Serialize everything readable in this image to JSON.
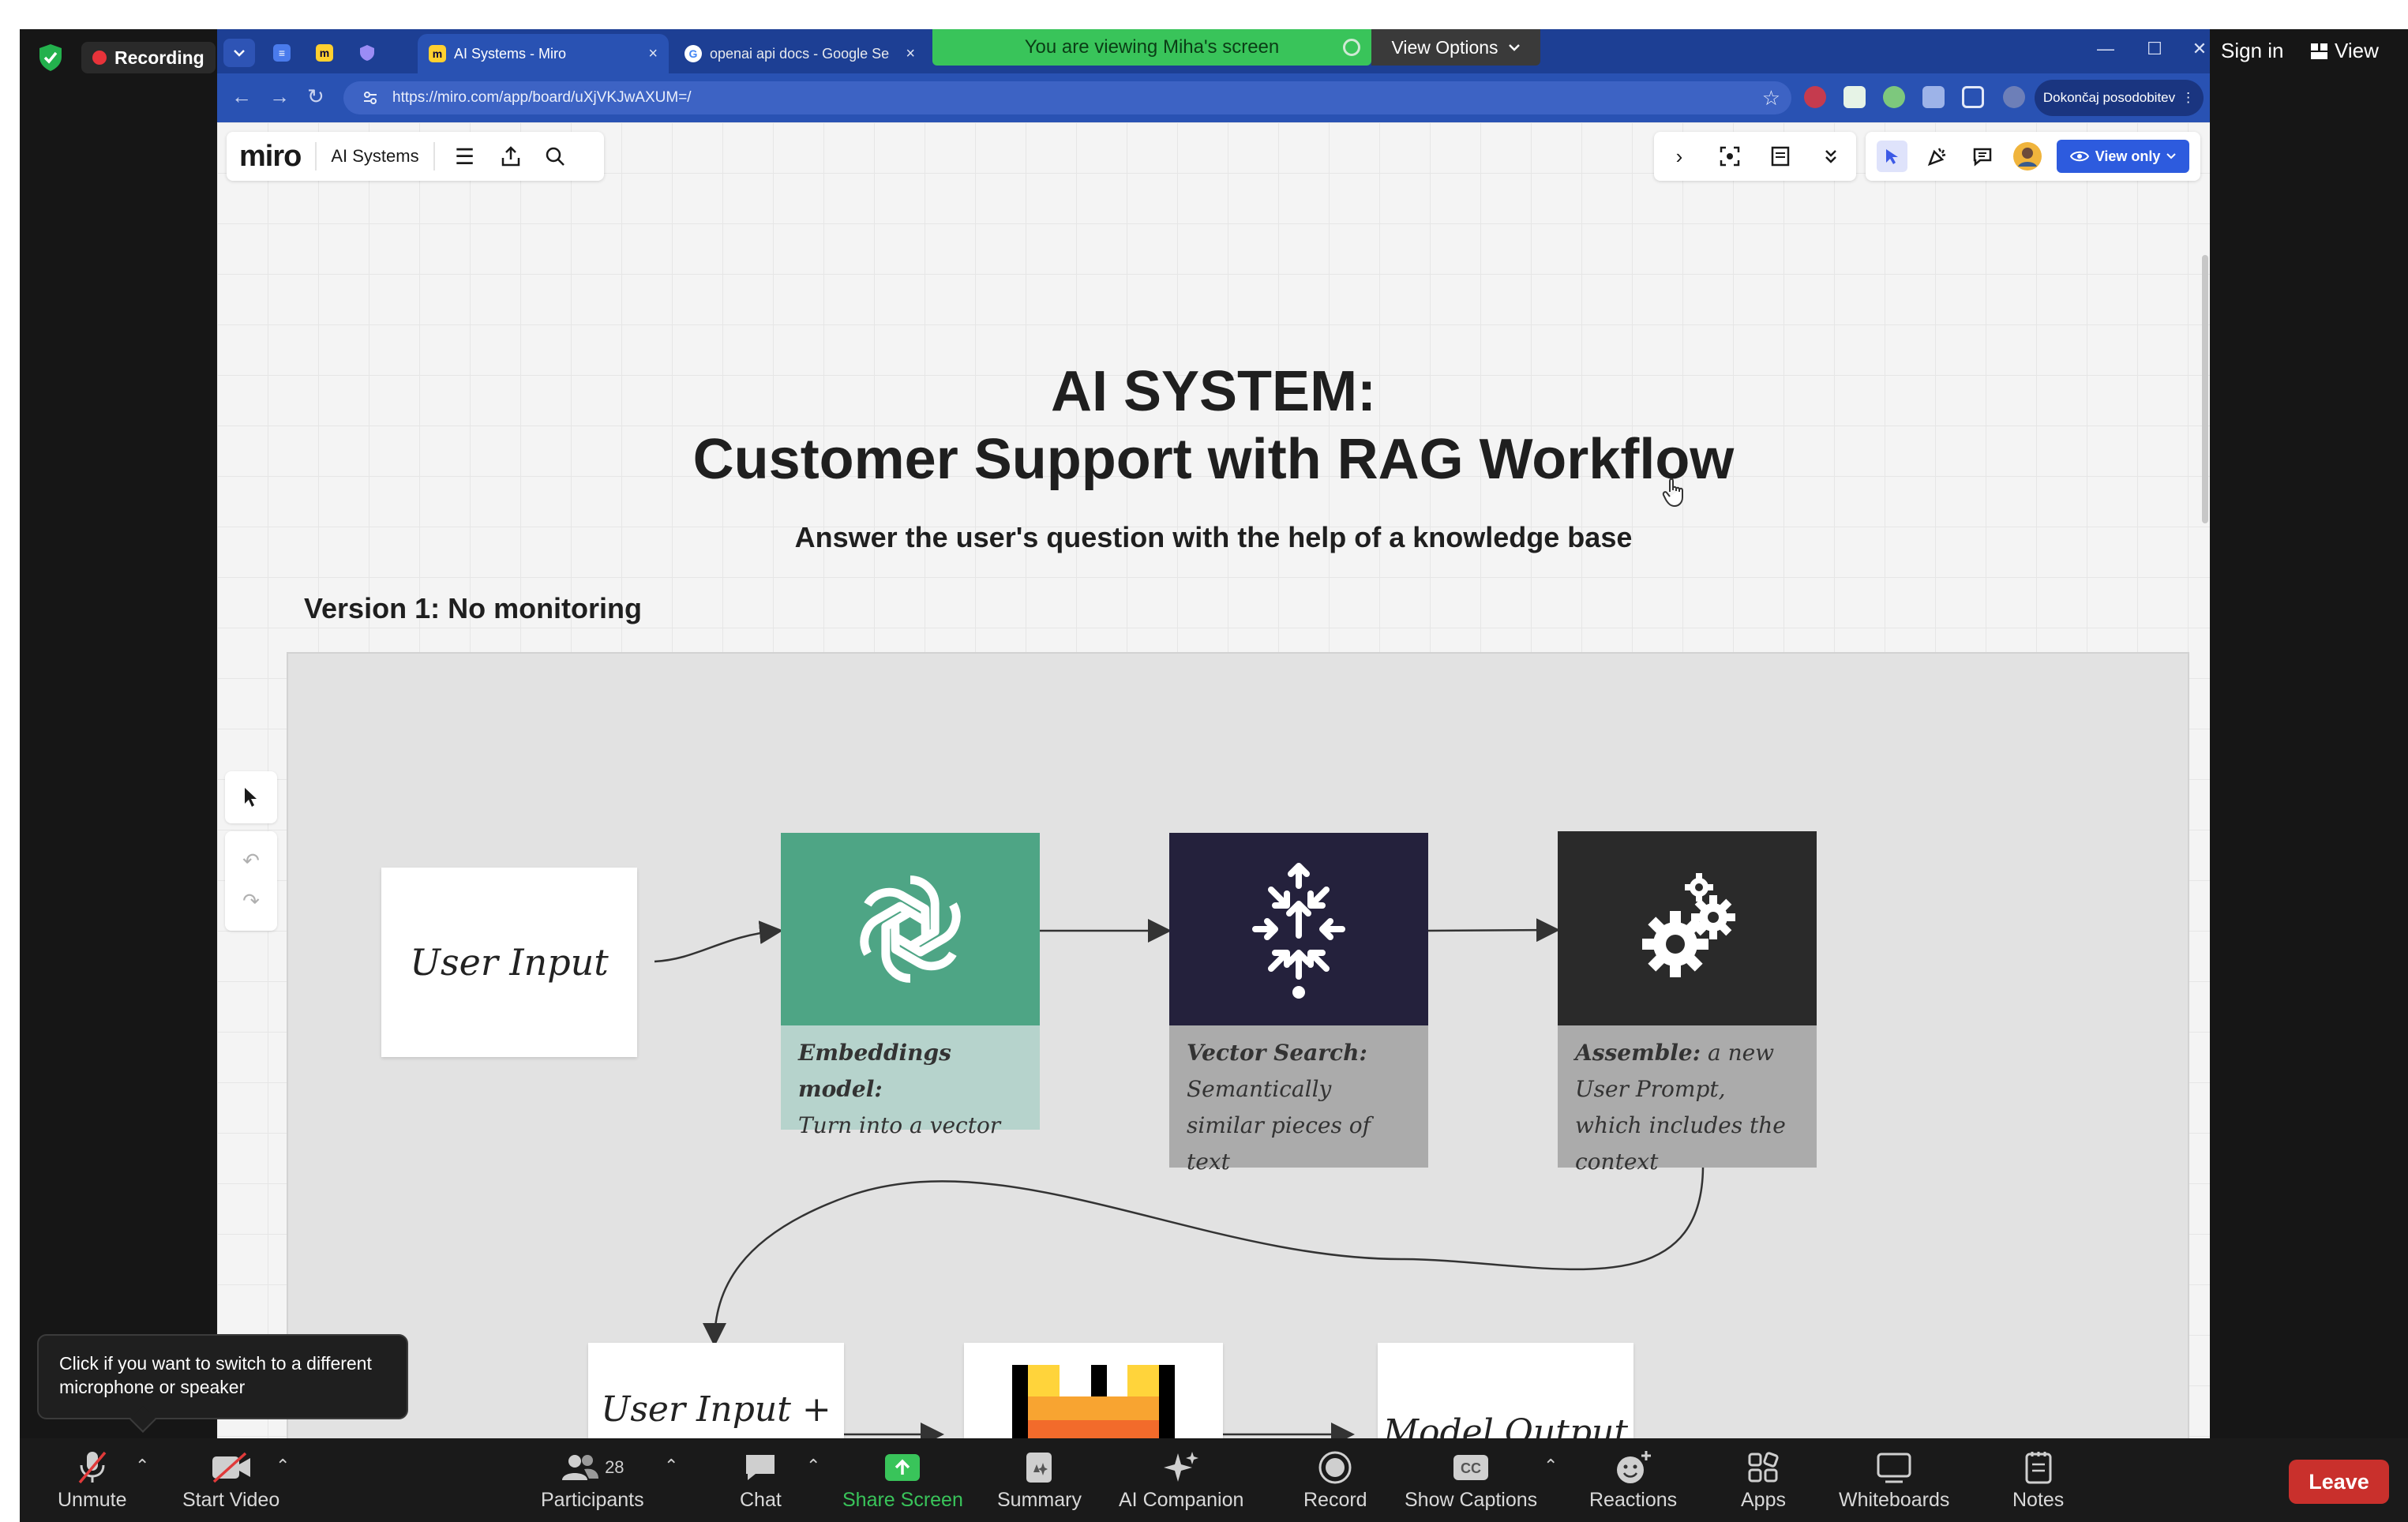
{
  "zoom": {
    "recording_label": "Recording",
    "sign_in": "Sign in",
    "view_label": "View",
    "viewing_banner": "You are viewing Miha's screen",
    "view_options": "View Options",
    "mic_tooltip": "Click if you want to switch to a different microphone or speaker",
    "toolbar": {
      "unmute": "Unmute",
      "start_video": "Start Video",
      "participants": "Participants",
      "participants_count": "28",
      "chat": "Chat",
      "share_screen": "Share Screen",
      "summary": "Summary",
      "ai_companion": "AI Companion",
      "record": "Record",
      "show_captions": "Show Captions",
      "reactions": "Reactions",
      "apps": "Apps",
      "whiteboards": "Whiteboards",
      "notes": "Notes",
      "leave": "Leave"
    },
    "colors": {
      "share_green": "#39c45a",
      "leave_red": "#c9302c",
      "toolbar_bg": "#1a1a1a"
    }
  },
  "browser": {
    "tabs": [
      {
        "title": "AI Systems - Miro",
        "active": true
      },
      {
        "title": "openai api docs - Google Searc",
        "active": false
      }
    ],
    "url": "https://miro.com/app/board/uXjVKJwAXUM=/",
    "finish_update": "Dokončaj posodobitev",
    "colors": {
      "tab_bar": "#1d3f94",
      "address_bar": "#2952b3"
    }
  },
  "miro": {
    "logo": "miro",
    "board_name": "AI Systems",
    "view_only": "View only",
    "title_line1": "AI SYSTEM:",
    "title_line2": "Customer Support with RAG Workflow",
    "subtitle": "Answer the user's question with the help of a knowledge base",
    "version_label": "Version 1: No monitoring",
    "nodes": {
      "user_input": "User Input",
      "embeddings_title": "Embeddings model:",
      "embeddings_desc": "Turn into a vector",
      "vector_title": "Vector Search:",
      "vector_desc": "Semantically similar pieces of text",
      "assemble_title": "Assemble:",
      "assemble_desc": "a new User Prompt, which includes the context",
      "user_input_context": "User Input + Context",
      "model_output": "Model Output"
    },
    "colors": {
      "openai_green": "#4ea585",
      "embeddings_caption": "#b6d3cc",
      "vector_dark": "#24213c",
      "assemble_dark": "#2a2a2a",
      "gray_caption": "#ababab",
      "view_only_blue": "#2d5bde"
    }
  }
}
